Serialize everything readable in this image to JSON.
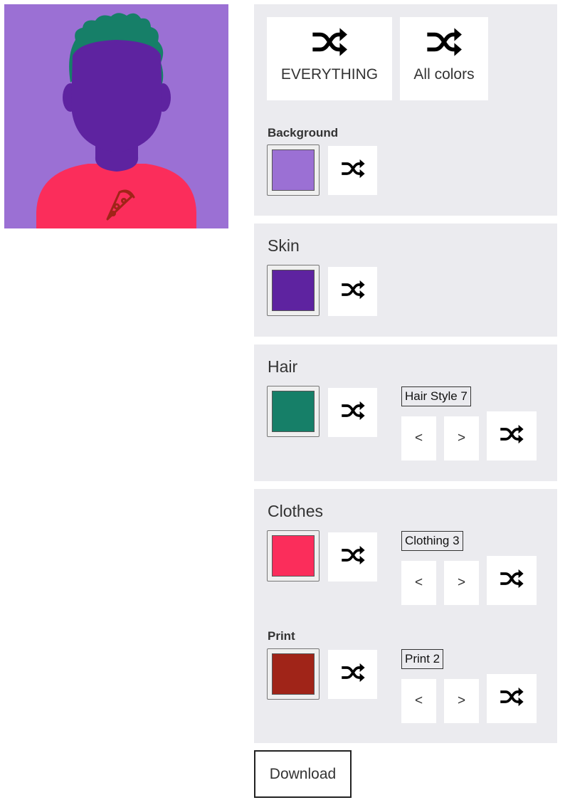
{
  "colors": {
    "background": "#9b70d4",
    "skin": "#5e23a0",
    "hair": "#167f68",
    "clothes": "#fb2d5b",
    "print": "#a02418",
    "panel": "#ebebef"
  },
  "randomize": {
    "everything_label": "EVERYTHING",
    "all_colors_label": "All colors",
    "icon": "shuffle-icon"
  },
  "background_section": {
    "title": "Background"
  },
  "skin_section": {
    "title": "Skin"
  },
  "hair_section": {
    "title": "Hair",
    "style_label": "Hair Style 7"
  },
  "clothes_section": {
    "title": "Clothes",
    "style_label": "Clothing 3"
  },
  "print_section": {
    "title": "Print",
    "style_label": "Print 2"
  },
  "nav": {
    "prev": "<",
    "next": ">"
  },
  "download_label": "Download"
}
